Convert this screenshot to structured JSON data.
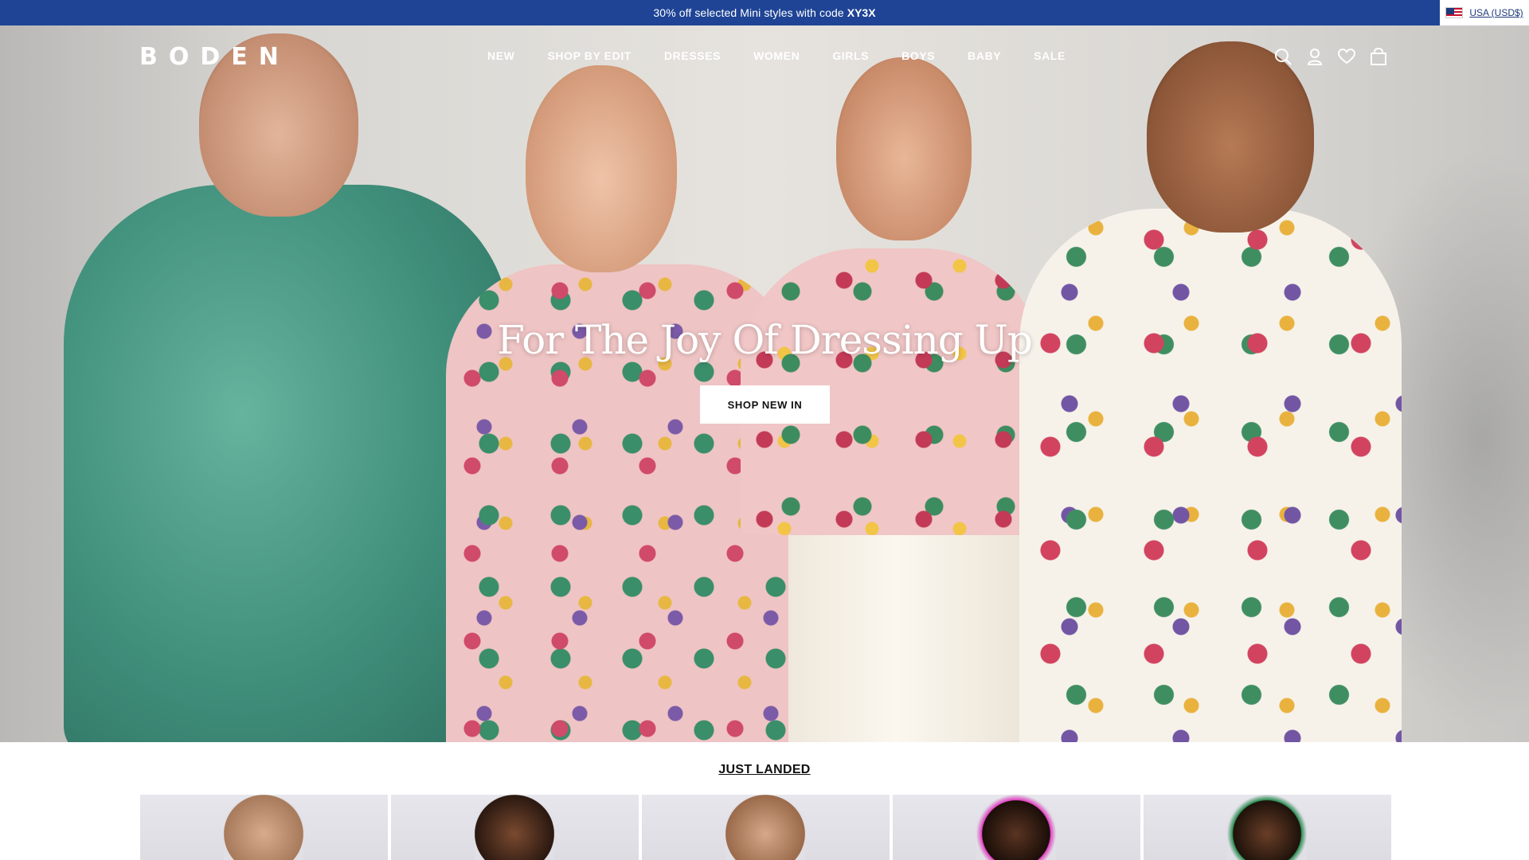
{
  "promo": {
    "text": "30% off selected Mini styles with code",
    "code": "XY3X"
  },
  "locale": {
    "label": "USA (USD$)",
    "flag": "us-flag-icon"
  },
  "brand": {
    "logo": "BODEN"
  },
  "nav": {
    "items": [
      "NEW",
      "SHOP BY EDIT",
      "DRESSES",
      "WOMEN",
      "GIRLS",
      "BOYS",
      "BABY",
      "SALE"
    ]
  },
  "header_icons": [
    "search-icon",
    "account-icon",
    "wishlist-heart-icon",
    "bag-icon"
  ],
  "hero": {
    "title": "For The Joy Of Dressing Up",
    "cta": "SHOP NEW IN"
  },
  "just_landed": {
    "title": "JUST LANDED",
    "products": [
      {
        "tone": "#c99a7a"
      },
      {
        "tone": "#3a2418"
      },
      {
        "tone": "#c79e83"
      },
      {
        "tone": "#2a1a12"
      },
      {
        "tone": "#3a2418"
      }
    ]
  },
  "colors": {
    "promo_bar": "#1f4496",
    "hero_text": "#ffffff",
    "cta_bg": "#ffffff"
  }
}
